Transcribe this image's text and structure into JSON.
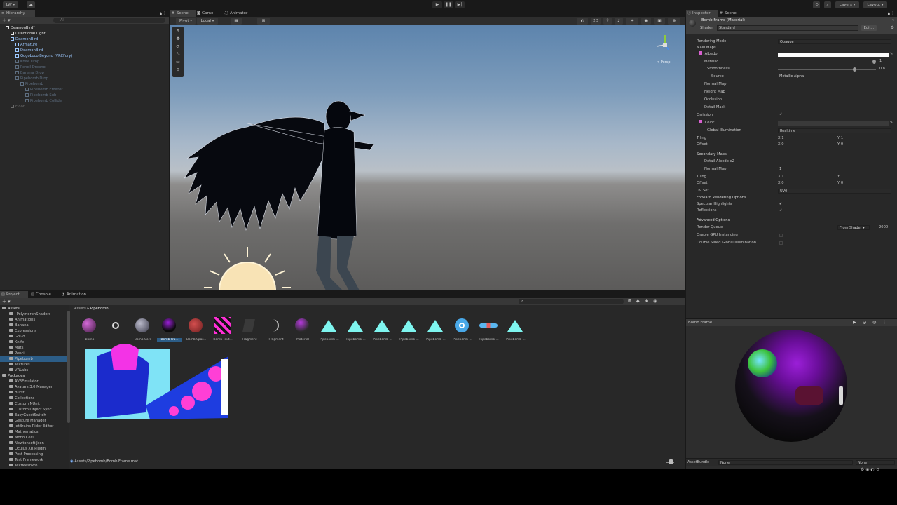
{
  "toolbar": {
    "account_label": "LW",
    "cloud_label": "",
    "play_icons": [
      "▶",
      "❚❚",
      "▶|"
    ],
    "layers_label": "Layers",
    "layout_label": "Layout"
  },
  "hierarchy": {
    "tab_label": "Hierarchy",
    "search_placeholder": "All",
    "items": [
      {
        "label": "DeamonBird*",
        "depth": 0,
        "color": "#e8e8e8",
        "kind": "scene"
      },
      {
        "label": "Directional Light",
        "depth": 1,
        "color": "#e8e8e8",
        "kind": "go"
      },
      {
        "label": "DeamonBird",
        "depth": 1,
        "color": "#9cc8ff",
        "kind": "prefab"
      },
      {
        "label": "Armature",
        "depth": 2,
        "color": "#9cc8ff",
        "kind": "prefab"
      },
      {
        "label": "DeamonBird",
        "depth": 2,
        "color": "#9cc8ff",
        "kind": "prefab"
      },
      {
        "label": "GogoLoco Beyond (VRCFury)",
        "depth": 2,
        "color": "#9cc8ff",
        "kind": "prefab"
      },
      {
        "label": "Knife Drop",
        "depth": 2,
        "color": "#5e6e80",
        "kind": "prefab"
      },
      {
        "label": "Pencil Dropno",
        "depth": 2,
        "color": "#5e6e80",
        "kind": "prefab"
      },
      {
        "label": "Banana Drop",
        "depth": 2,
        "color": "#5e6e80",
        "kind": "prefab"
      },
      {
        "label": "Pipebomb Drop",
        "depth": 2,
        "color": "#5e6e80",
        "kind": "prefab"
      },
      {
        "label": "Pipebomb",
        "depth": 3,
        "color": "#5e6e80",
        "kind": "prefab"
      },
      {
        "label": "Pipebomb Emitter",
        "depth": 4,
        "color": "#5e6e80",
        "kind": "prefab"
      },
      {
        "label": "Pipebomb Sub",
        "depth": 4,
        "color": "#5e6e80",
        "kind": "prefab"
      },
      {
        "label": "Pipebomb Collider",
        "depth": 4,
        "color": "#5e6e80",
        "kind": "prefab"
      },
      {
        "label": "Floor",
        "depth": 1,
        "color": "#6a6a6a",
        "kind": "go"
      }
    ]
  },
  "scene": {
    "tabs": [
      "Scene",
      "Game",
      "Animator"
    ],
    "pivot_label": "Pivot",
    "local_label": "Local",
    "mode_2d": "2D",
    "persp_label": "< Persp"
  },
  "inspector": {
    "tabs": [
      "Inspector",
      "Scene"
    ],
    "material_name": "Bomb Frame (Material)",
    "shader_label": "Shader",
    "shader_value": "Standard",
    "edit_label": "Edit...",
    "rendering_mode_label": "Rendering Mode",
    "rendering_mode_value": "Opaque",
    "main_maps_header": "Main Maps",
    "albedo_label": "Albedo",
    "metallic_label": "Metallic",
    "metallic_value": "1",
    "smoothness_label": "Smoothness",
    "smoothness_value": "0.8",
    "source_label": "Source",
    "source_value": "Metallic Alpha",
    "normal_map_label": "Normal Map",
    "height_map_label": "Height Map",
    "occlusion_label": "Occlusion",
    "detail_mask_label": "Detail Mask",
    "emission_label": "Emission",
    "color_label": "Color",
    "global_illum_label": "Global Illumination",
    "global_illum_value": "Realtime",
    "tiling_label": "Tiling",
    "offset_label": "Offset",
    "tiling": {
      "x": "1",
      "y": "1"
    },
    "offset": {
      "x": "0",
      "y": "0"
    },
    "secondary_maps_header": "Secondary Maps",
    "detail_albedo_label": "Detail Albedo x2",
    "sec_normal_map_label": "Normal Map",
    "sec_normal_value": "1",
    "sec_tiling": {
      "x": "1",
      "y": "1"
    },
    "sec_offset": {
      "x": "0",
      "y": "0"
    },
    "uv_set_label": "UV Set",
    "uv_set_value": "UV0",
    "forward_header": "Forward Rendering Options",
    "specular_label": "Specular Highlights",
    "reflections_label": "Reflections",
    "advanced_header": "Advanced Options",
    "render_queue_label": "Render Queue",
    "render_queue_mode": "From Shader",
    "render_queue_value": "2000",
    "gpu_instancing_label": "Enable GPU Instancing",
    "double_sided_label": "Double Sided Global Illumination"
  },
  "project": {
    "tabs": [
      "Project",
      "Console",
      "Animation"
    ],
    "breadcrumb": [
      "Assets",
      "Pipebomb"
    ],
    "tree": [
      {
        "label": "Assets",
        "depth": 0,
        "bold": true
      },
      {
        "label": "_PolymorphShaders",
        "depth": 1
      },
      {
        "label": "Animations",
        "depth": 1
      },
      {
        "label": "Banana",
        "depth": 1
      },
      {
        "label": "Expressions",
        "depth": 1
      },
      {
        "label": "GoGo",
        "depth": 1
      },
      {
        "label": "Knife",
        "depth": 1
      },
      {
        "label": "Mats",
        "depth": 1
      },
      {
        "label": "Pencil",
        "depth": 1
      },
      {
        "label": "Pipebomb",
        "depth": 1,
        "selected": true
      },
      {
        "label": "Textures",
        "depth": 1
      },
      {
        "label": "VRLabs",
        "depth": 1
      },
      {
        "label": "Packages",
        "depth": 0,
        "bold": true
      },
      {
        "label": "AV3Emulator",
        "depth": 1
      },
      {
        "label": "Avatars 3.0 Manager",
        "depth": 1
      },
      {
        "label": "Burst",
        "depth": 1
      },
      {
        "label": "Collections",
        "depth": 1
      },
      {
        "label": "Custom NUnit",
        "depth": 1
      },
      {
        "label": "Custom Object Sync",
        "depth": 1
      },
      {
        "label": "EasyGuestSwitch",
        "depth": 1
      },
      {
        "label": "Gesture Manager",
        "depth": 1
      },
      {
        "label": "JetBrains Rider Editor",
        "depth": 1
      },
      {
        "label": "Mathematics",
        "depth": 1
      },
      {
        "label": "Mono Cecil",
        "depth": 1
      },
      {
        "label": "Newtonsoft Json",
        "depth": 1
      },
      {
        "label": "Oculus XR Plugin",
        "depth": 1
      },
      {
        "label": "Post Processing",
        "depth": 1
      },
      {
        "label": "Test Framework",
        "depth": 1
      },
      {
        "label": "TextMeshPro",
        "depth": 1
      }
    ],
    "assets": [
      {
        "label": "Bomb",
        "kind": "sphere-multi"
      },
      {
        "label": "",
        "kind": "mesh"
      },
      {
        "label": "Bomb Core",
        "kind": "sphere-grey"
      },
      {
        "label": "Bomb Fra...",
        "kind": "sphere-dark",
        "selected": true
      },
      {
        "label": "Bomb Spar...",
        "kind": "sphere-red"
      },
      {
        "label": "Bomb Text...",
        "kind": "texture"
      },
      {
        "label": "Fragment",
        "kind": "mesh-dark"
      },
      {
        "label": "Fragment",
        "kind": "mesh-curve"
      },
      {
        "label": "Material",
        "kind": "sphere-multi2"
      },
      {
        "label": "Pipebomb ...",
        "kind": "vfx"
      },
      {
        "label": "Pipebomb ...",
        "kind": "vfx"
      },
      {
        "label": "Pipebomb ...",
        "kind": "vfx"
      },
      {
        "label": "Pipebomb ...",
        "kind": "vfx"
      },
      {
        "label": "Pipebomb ...",
        "kind": "vfx"
      },
      {
        "label": "Pipebomb ...",
        "kind": "ring"
      },
      {
        "label": "Pipebomb ...",
        "kind": "pipe"
      },
      {
        "label": "Pipebomb ...",
        "kind": "vfx"
      }
    ],
    "path": "Assets/Pipebomb/Bomb Frame.mat"
  },
  "preview": {
    "title": "Bomb Frame",
    "assetbundle_label": "AssetBundle",
    "assetbundle_value": "None",
    "variant_value": "None"
  },
  "colors": {
    "accent_selection": "#2c5d87",
    "link_blue": "#9cc8ff",
    "vfx_cyan": "#7ef5ef"
  }
}
